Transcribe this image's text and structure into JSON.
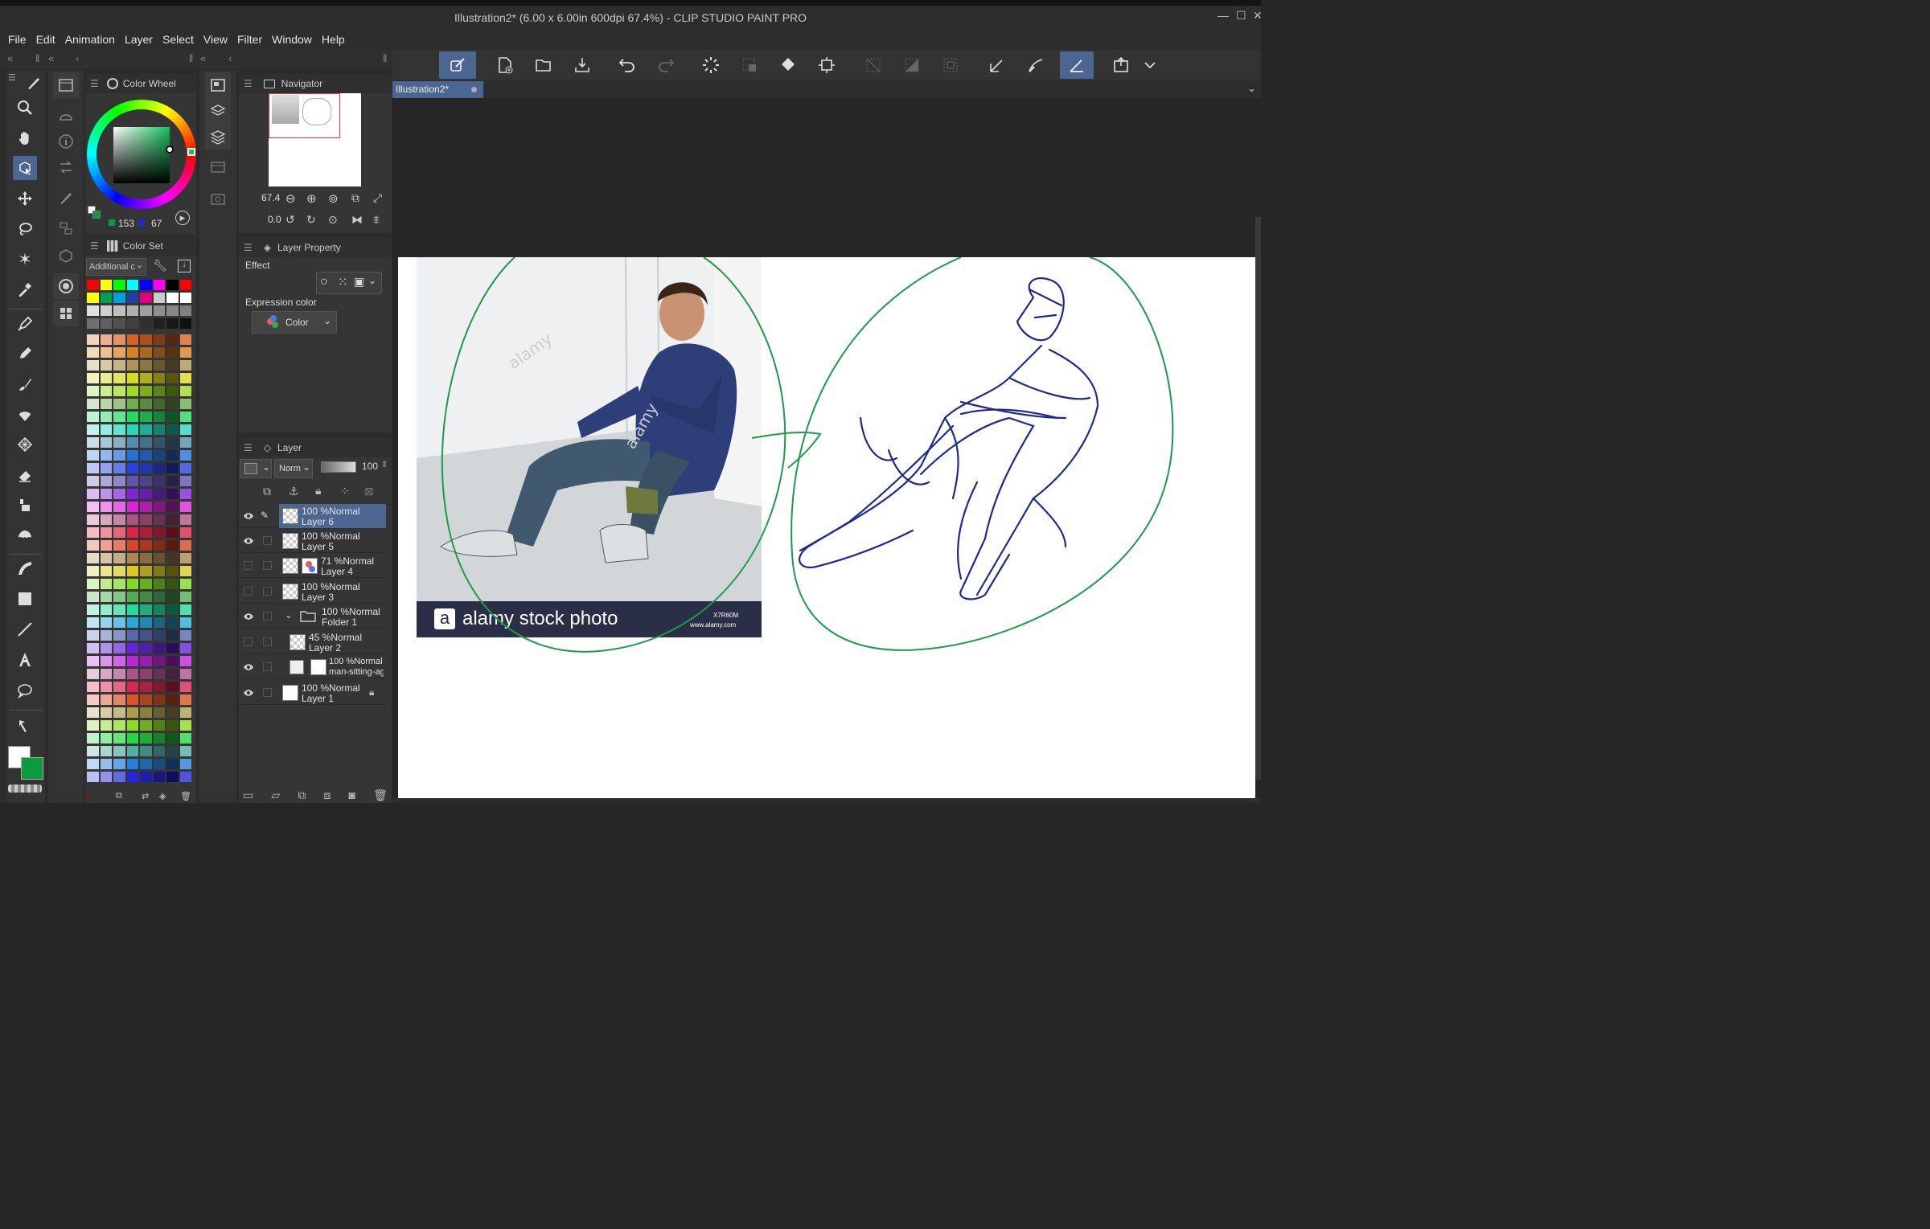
{
  "window": {
    "title": "Illustration2* (6.00 x 6.00in 600dpi 67.4%)  - CLIP STUDIO PAINT PRO"
  },
  "menu": [
    "File",
    "Edit",
    "Animation",
    "Layer",
    "Select",
    "View",
    "Filter",
    "Window",
    "Help"
  ],
  "tools": [
    {
      "name": "pen-stroke-icon"
    },
    {
      "name": "zoom-icon"
    },
    {
      "name": "hand-icon"
    },
    {
      "name": "operation-icon"
    },
    {
      "name": "move-layer-icon"
    },
    {
      "name": "lasso-icon"
    },
    {
      "name": "auto-select-icon"
    },
    {
      "name": "eyedropper-icon"
    },
    {
      "name": "pen-icon"
    },
    {
      "name": "pencil-icon"
    },
    {
      "name": "brush-icon"
    },
    {
      "name": "airbrush-icon"
    },
    {
      "name": "decoration-icon"
    },
    {
      "name": "eraser-icon"
    },
    {
      "name": "blend-icon"
    },
    {
      "name": "fill-icon"
    },
    {
      "name": "gradient-icon"
    },
    {
      "name": "figure-icon"
    },
    {
      "name": "ruler-icon"
    },
    {
      "name": "text-icon"
    },
    {
      "name": "balloon-icon"
    },
    {
      "name": "correct-line-icon"
    }
  ],
  "colors": {
    "main": "#ffffff",
    "sub": "#0a9b41",
    "accent": "#4b6690",
    "sketch": "#1e2a8e",
    "green_stroke": "#1f9a4a"
  },
  "color_wheel": {
    "title": "Color Wheel",
    "val_a": "153",
    "val_b": "67"
  },
  "color_set": {
    "title": "Color Set",
    "dropdown": "Additional c"
  },
  "navigator": {
    "title": "Navigator",
    "zoom": "67.4",
    "rotation": "0.0"
  },
  "layer_property": {
    "title": "Layer Property",
    "effect_label": "Effect",
    "expression_label": "Expression color",
    "expression_value": "Color"
  },
  "layer_panel": {
    "title": "Layer",
    "blend": "Norm",
    "opacity": "100"
  },
  "layers": [
    {
      "pct": "100 %Normal",
      "name": "Layer 6",
      "selected": true,
      "visible": true
    },
    {
      "pct": "100 %Normal",
      "name": "Layer 5",
      "visible": true
    },
    {
      "pct": "71 %Normal",
      "name": "Layer 4",
      "visible": false
    },
    {
      "pct": "100 %Normal",
      "name": "Layer 3",
      "visible": false
    },
    {
      "pct": "100 %Normal",
      "name": "Folder 1",
      "visible": true,
      "folder": true
    },
    {
      "pct": "45 %Normal",
      "name": "Layer 2",
      "visible": false
    },
    {
      "pct": "100 %Normal",
      "name": "man-sitting-agai",
      "visible": true
    },
    {
      "pct": "100 %Normal",
      "name": "Layer 1",
      "visible": true,
      "locked": true
    }
  ],
  "canvas": {
    "tab": "Illustration2*",
    "zoom_readout": "67.4",
    "rot_readout": "0.0"
  },
  "photo": {
    "logo_letter": "a",
    "brand": "alamy stock photo",
    "code": "X7R60M",
    "site": "www.alamy.com",
    "watermark": "alamy"
  }
}
